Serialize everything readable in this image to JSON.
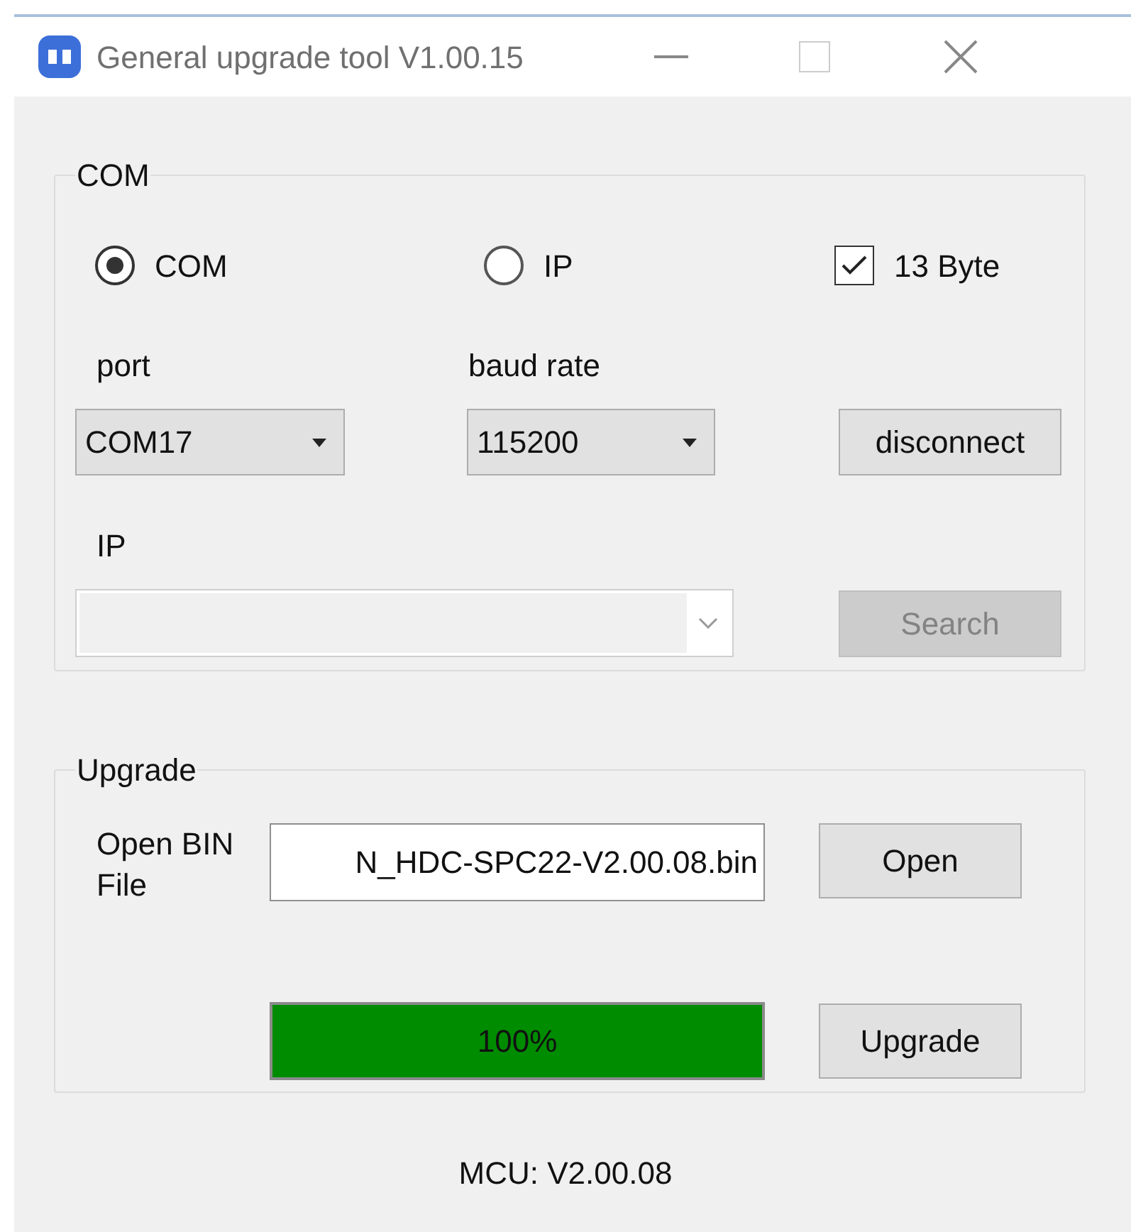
{
  "window": {
    "title": "General upgrade tool V1.00.15"
  },
  "com_group": {
    "title": "COM",
    "connection": [
      {
        "label": "COM",
        "selected": true
      },
      {
        "label": "IP",
        "selected": false
      }
    ],
    "byte_option": {
      "label": "13 Byte",
      "checked": true
    },
    "port": {
      "label": "port",
      "value": "COM17"
    },
    "baud_rate": {
      "label": "baud rate",
      "value": "115200"
    },
    "connect_button": "disconnect",
    "ip": {
      "label": "IP"
    },
    "search_button": {
      "label": "Search",
      "disabled": true
    }
  },
  "upgrade_group": {
    "title": "Upgrade",
    "file_label": "Open BIN File",
    "file_value": "N_HDC-SPC22-V2.00.08.bin",
    "open_button": "Open",
    "progress": {
      "level": 1,
      "reading": "100%"
    },
    "upgrade_button": "Upgrade"
  },
  "mcu_version": "MCU: V2.00.08"
}
